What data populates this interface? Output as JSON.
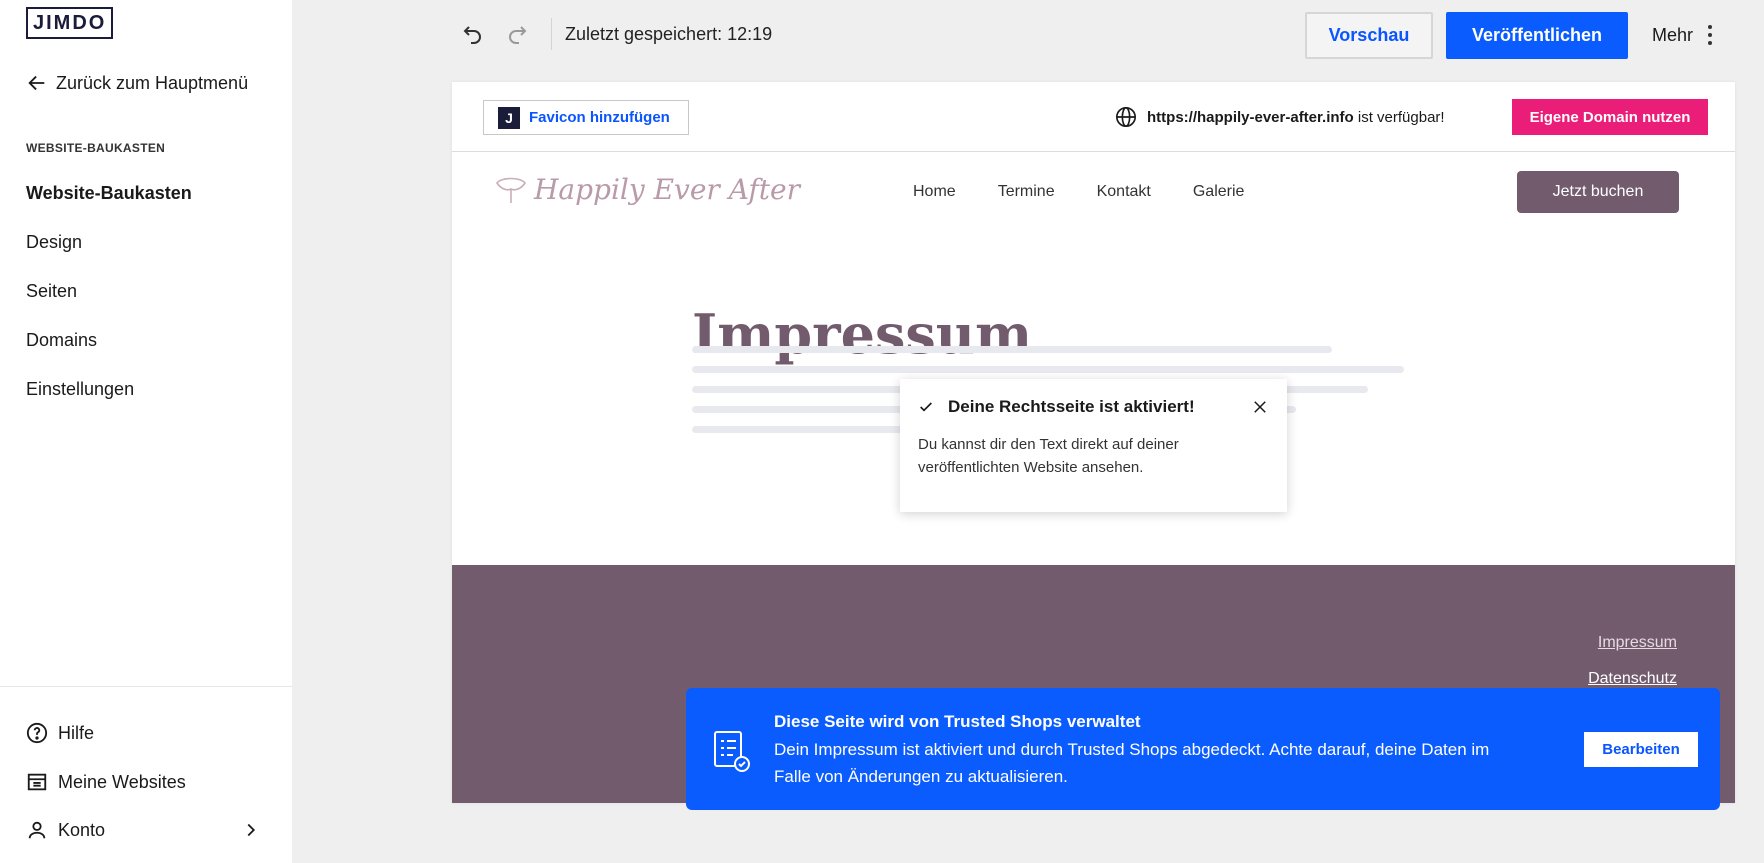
{
  "sidebar": {
    "logo": "JIMDO",
    "back_label": "Zurück zum Hauptmenü",
    "section_label": "WEBSITE-BAUKASTEN",
    "items": [
      {
        "label": "Website-Baukasten",
        "active": true
      },
      {
        "label": "Design"
      },
      {
        "label": "Seiten"
      },
      {
        "label": "Domains"
      },
      {
        "label": "Einstellungen"
      }
    ],
    "bottom": {
      "help": "Hilfe",
      "websites": "Meine Websites",
      "account": "Konto"
    }
  },
  "toolbar": {
    "saved_text": "Zuletzt gespeichert: 12:19",
    "preview_label": "Vorschau",
    "publish_label": "Veröffentlichen",
    "more_label": "Mehr"
  },
  "domain_bar": {
    "favicon_label": "Favicon hinzufügen",
    "favicon_letter": "J",
    "domain_url": "https://happily-ever-after.info",
    "domain_suffix": " ist verfügbar!",
    "domain_button": "Eigene Domain nutzen"
  },
  "site": {
    "logo_text": "Happily Ever After",
    "nav": [
      "Home",
      "Termine",
      "Kontakt",
      "Galerie"
    ],
    "book_button": "Jetzt buchen",
    "page_title": "Impressum",
    "footer_links": [
      "Impressum",
      "Datenschutz"
    ]
  },
  "toast": {
    "title": "Deine Rechtsseite ist aktiviert!",
    "body": "Du kannst dir den Text direkt auf deiner veröffentlichten Website ansehen."
  },
  "trusted_shops": {
    "title": "Diese Seite wird von Trusted Shops verwaltet",
    "text": "Dein Impressum ist aktiviert und durch Trusted Shops abgedeckt. Achte darauf, deine Daten im Falle von Änderungen zu aktualisieren.",
    "button": "Bearbeiten"
  },
  "colors": {
    "accent_blue": "#0a5cff",
    "domain_pink": "#ea1e78",
    "site_mauve": "#735b6e"
  }
}
